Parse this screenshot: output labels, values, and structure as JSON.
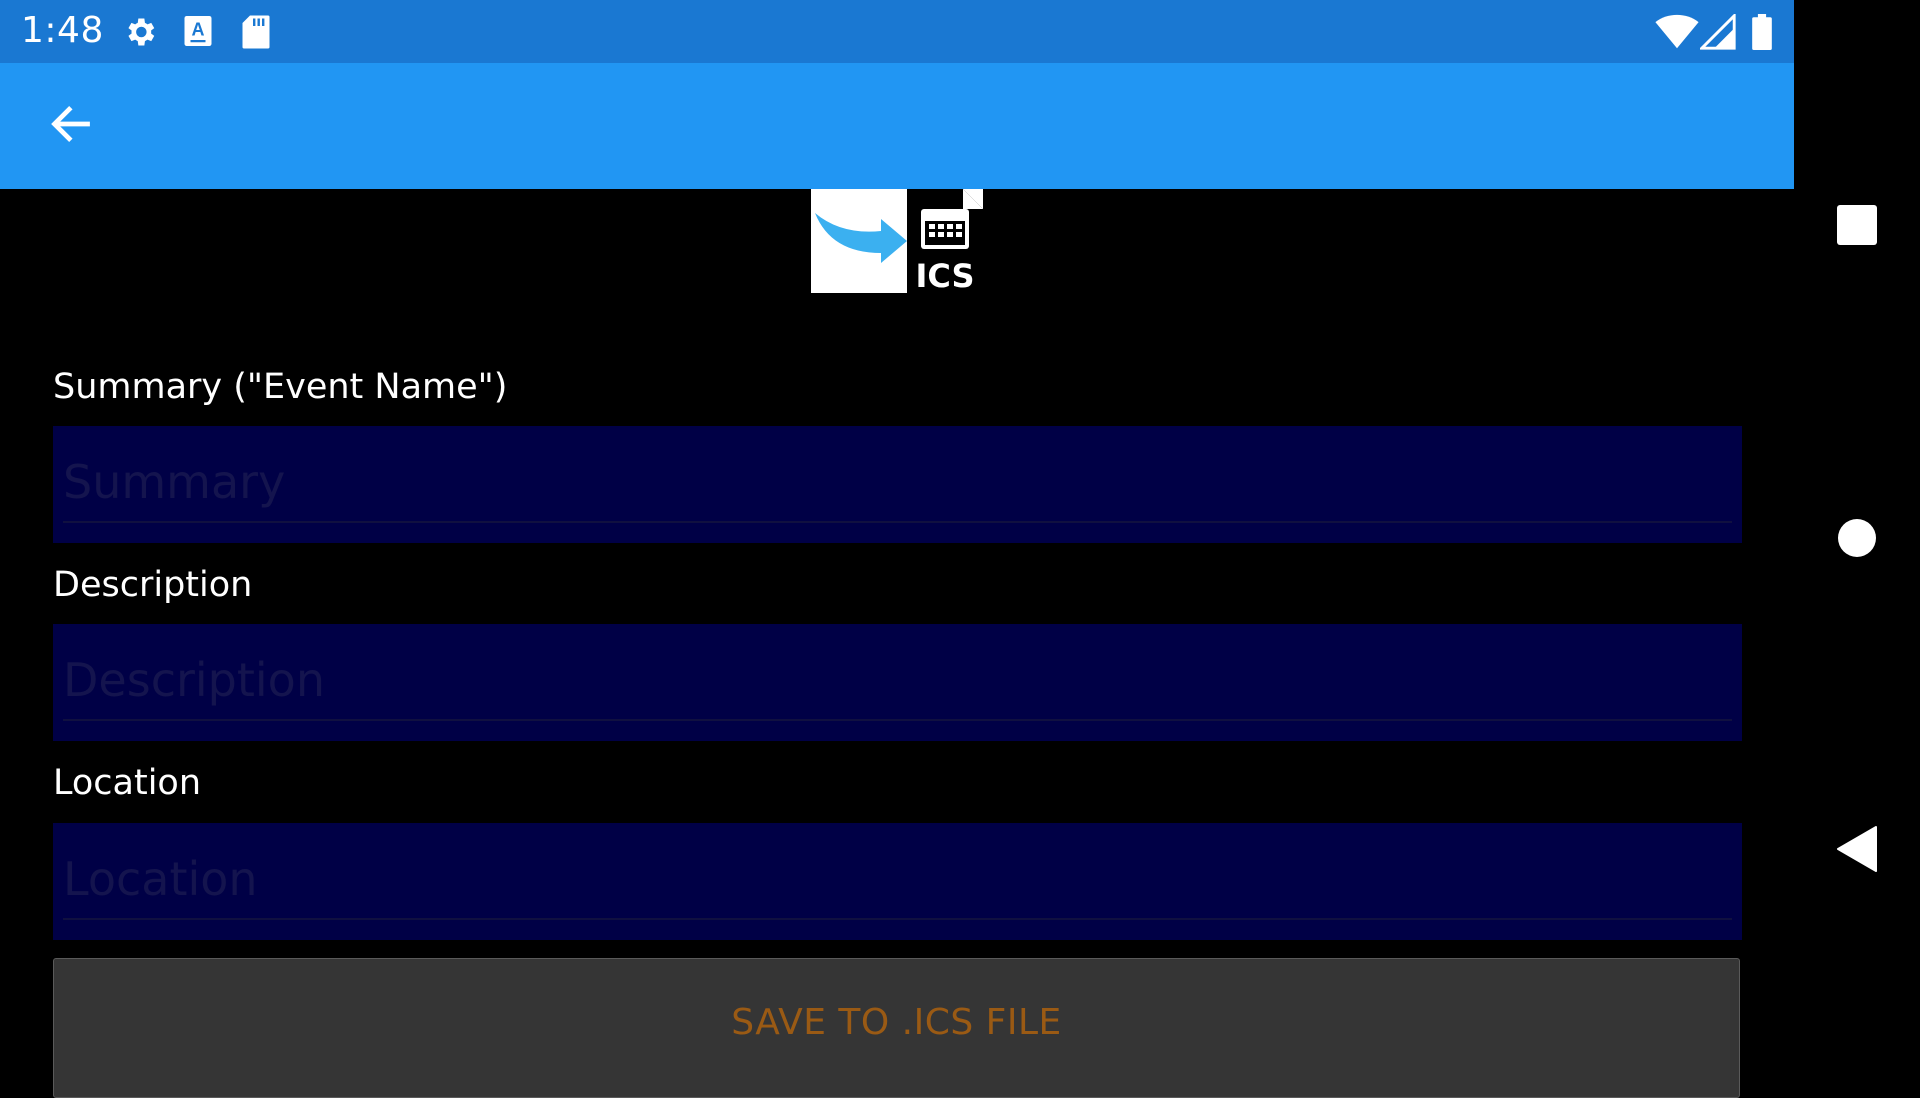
{
  "status_bar": {
    "time": "1:48",
    "icons": [
      "gear-icon",
      "keyboard-a-icon",
      "sd-card-icon",
      "wifi-icon",
      "signal-icon",
      "battery-icon"
    ]
  },
  "toolbar": {
    "back_icon": "arrow-left-icon"
  },
  "logo": {
    "text": "ICS",
    "colors": {
      "arrow": "#3bb0f0",
      "file": "#000000"
    }
  },
  "form": {
    "summary": {
      "label": "Summary (\"Event Name\")",
      "placeholder": "Summary",
      "value": ""
    },
    "description": {
      "label": "Description",
      "placeholder": "Description",
      "value": ""
    },
    "location": {
      "label": "Location",
      "placeholder": "Location",
      "value": ""
    },
    "save_label": "SAVE TO .ICS FILE"
  },
  "nav_bar": {
    "buttons": [
      "recents-square-icon",
      "home-circle-icon",
      "back-triangle-icon"
    ]
  },
  "colors": {
    "status_bar": "#1a78d2",
    "toolbar": "#2196f3",
    "field_bg": "#000046",
    "button_bg": "#353535",
    "button_text": "#9a5a14"
  }
}
